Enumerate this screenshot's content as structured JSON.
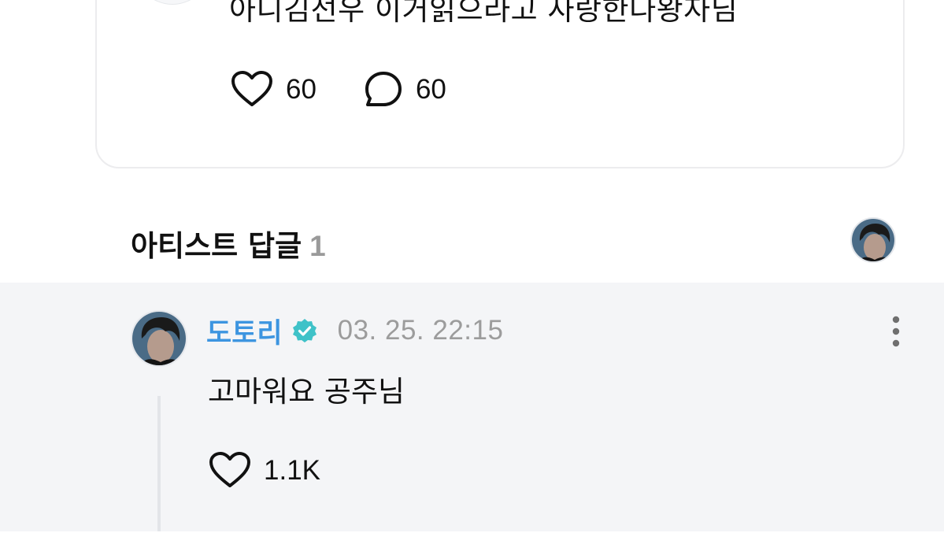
{
  "post": {
    "text": "아니김선우 이거읽으라고 사랑한다왕자님",
    "like_count": "60",
    "comment_count": "60"
  },
  "artist_replies": {
    "title": "아티스트 답글",
    "count": "1"
  },
  "reply": {
    "author": "도토리",
    "timestamp": "03. 25. 22:15",
    "text": "고마워요 공주님",
    "like_count": "1.1K"
  },
  "colors": {
    "author_blue": "#3d95e0",
    "verified_teal": "#3fc2c8",
    "panel_bg": "#f4f5f7",
    "muted_text": "#9c9c9c"
  },
  "icons": {
    "like": "heart-outline-icon",
    "comment": "speech-bubble-icon",
    "verified": "verified-badge-icon",
    "more": "vertical-ellipsis-icon"
  }
}
